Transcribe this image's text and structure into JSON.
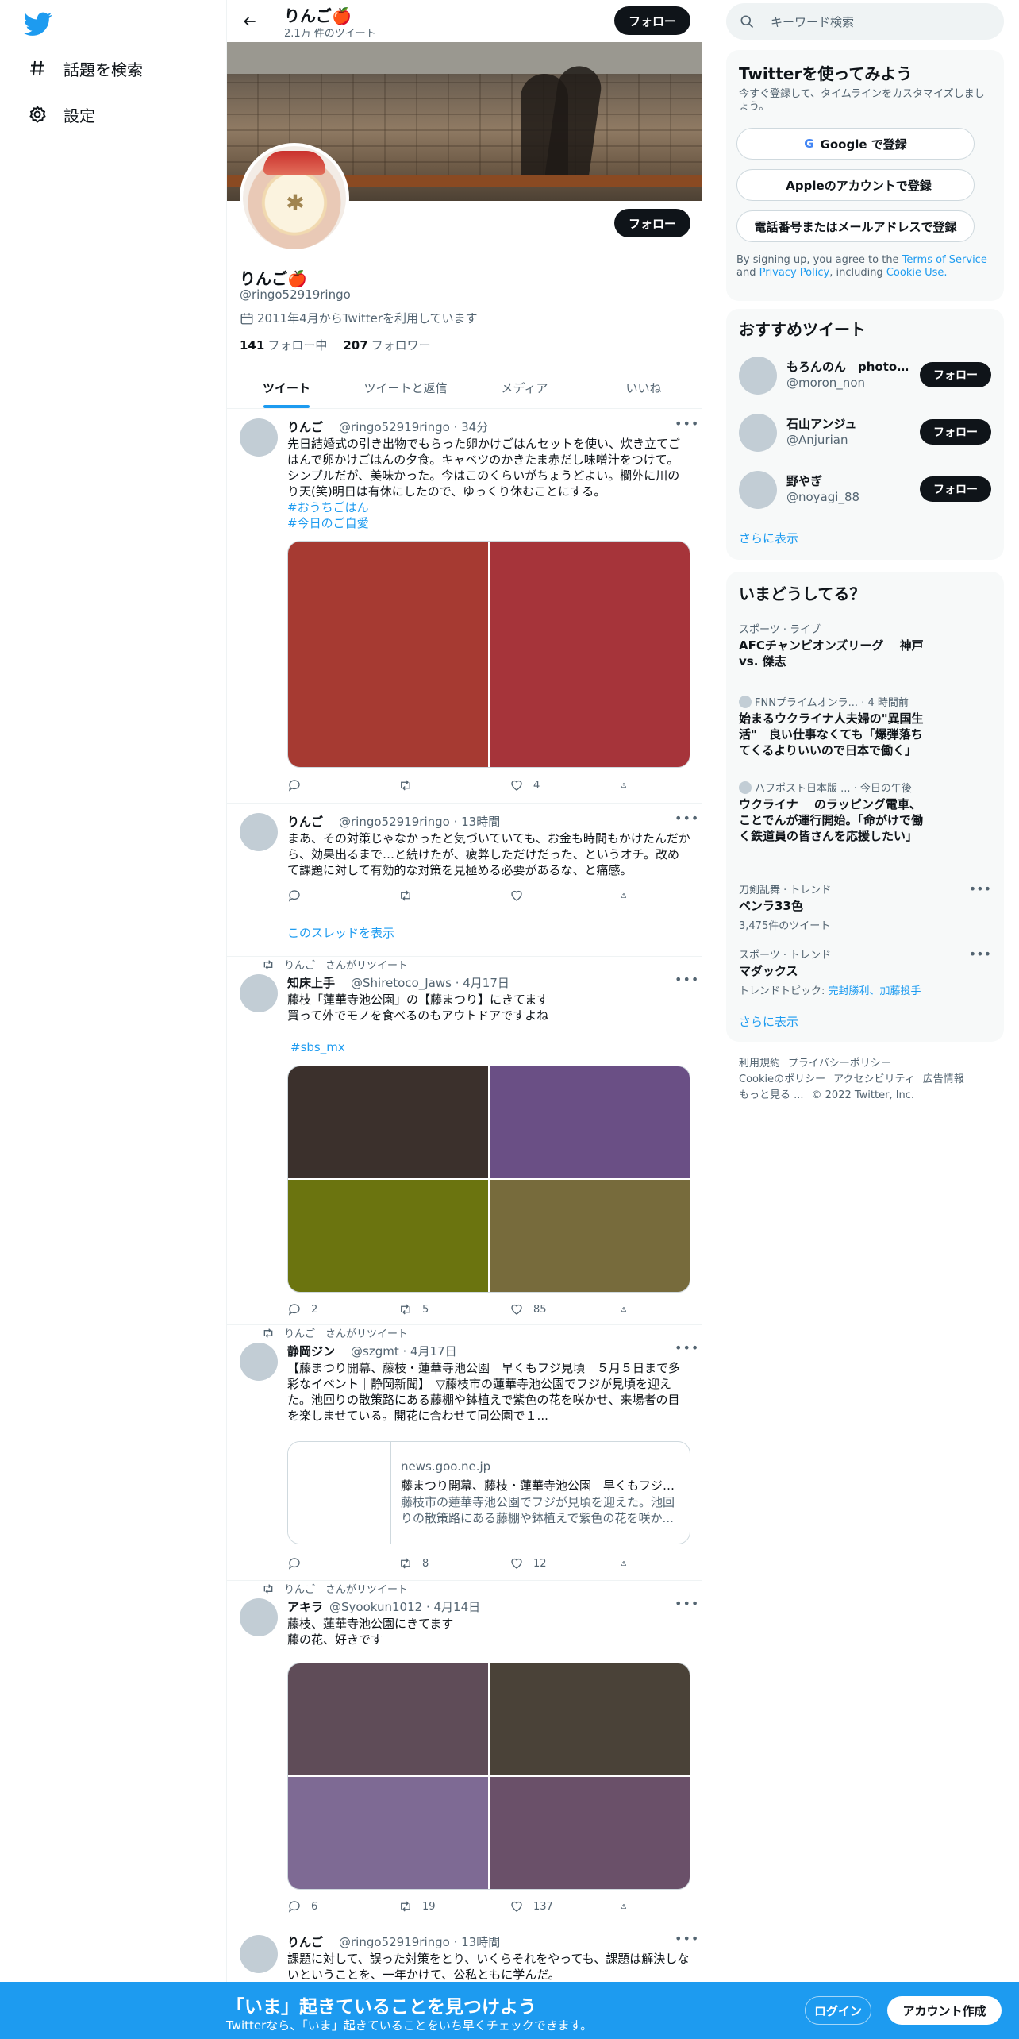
{
  "nav": {
    "explore_label": "話題を検索",
    "settings_label": "設定"
  },
  "header": {
    "name": "りんご🍎",
    "tweet_count": "2.1万 件のツイート",
    "follow_label": "フォロー"
  },
  "profile": {
    "name": "りんご🍎",
    "handle": "@ringo52919ringo",
    "joined": "2011年4月からTwitterを利用しています",
    "following_count": "141",
    "following_label": "フォロー中",
    "followers_count": "207",
    "followers_label": "フォロワー",
    "follow_label": "フォロー"
  },
  "tabs": [
    "ツイート",
    "ツイートと返信",
    "メディア",
    "いいね"
  ],
  "tweets": [
    {
      "name": "りんご",
      "handle_time": "@ringo52919ringo · 34分",
      "text": "先日結婚式の引き出物でもらった卵かけごはんセットを使い、炊き立てごはんで卵かけごはんの夕食。キャベツのかきたま赤だし味噌汁をつけて。シンプルだが、美味かった。今はこのくらいがちょうどよい。欄外に川のり天(笑)明日は有休にしたので、ゆっくり休むことにする。",
      "tags": [
        "#おうちごはん",
        "#今日のご自愛"
      ],
      "reply": "",
      "retweet": "",
      "like": "4",
      "media_colors": [
        "#a63a32",
        "#a6343a"
      ]
    },
    {
      "name": "りんご",
      "handle_time": "@ringo52919ringo · 13時間",
      "text": "まあ、その対策じゃなかったと気づいていても、お金も時間もかけたんだから、効果出るまで…と続けたが、疲弊しただけだった、というオチ。改めて課題に対して有効的な対策を見極める必要があるな、と痛感。",
      "reply": "",
      "retweet": "",
      "like": "",
      "show_thread": "このスレッドを表示"
    },
    {
      "rt_by": "りんご　さんがリツイート",
      "name": "知床上手",
      "handle_time": "@Shiretoco_Jaws · 4月17日",
      "text": "藤枝「蓮華寺池公園」の【藤まつり】にきてます\n買って外でモノを食べるのもアウトドアですよね",
      "tags": [
        "#sbs_mx"
      ],
      "reply": "2",
      "retweet": "5",
      "like": "85",
      "media_colors": [
        "#3b302c",
        "#6a4f85",
        "#6b740f",
        "#776b3c"
      ]
    },
    {
      "rt_by": "りんご　さんがリツイート",
      "name": "静岡ジン",
      "handle_time": "@szgmt · 4月17日",
      "text": "【藤まつり開幕、藤枝・蓮華寺池公園　早くもフジ見頃　５月５日まで多彩なイベント｜静岡新聞】　▽藤枝市の蓮華寺池公園でフジが見頃を迎えた。池回りの散策路にある藤棚や鉢植えで紫色の花を咲かせ、来場者の目を楽しませている。開花に合わせて同公園で１...",
      "card_domain": "news.goo.ne.jp",
      "card_title": "藤まつり開幕、藤枝・蓮華寺池公園　早くもフジ見頃",
      "card_desc": "藤枝市の蓮華寺池公園でフジが見頃を迎えた。池回りの散策路にある藤棚や鉢植えで紫色の花を咲か...",
      "reply": "",
      "retweet": "8",
      "like": "12"
    },
    {
      "rt_by": "りんご　さんがリツイート",
      "name": "アキラ",
      "handle_time": "@Syookun1012 · 4月14日",
      "text": "藤枝、蓮華寺池公園にきてます\n藤の花、好きです",
      "reply": "6",
      "retweet": "19",
      "like": "137",
      "media_colors": [
        "#5f4c58",
        "#4a4238",
        "#7e6a94",
        "#6a5069"
      ]
    },
    {
      "name": "りんご",
      "handle_time": "@ringo52919ringo · 13時間",
      "text": "課題に対して、誤った対策をとり、いくらそれをやっても、課題は解決しないということを、一年かけて、公私ともに学んだ。"
    }
  ],
  "search": {
    "placeholder": "キーワード検索"
  },
  "signup_card": {
    "title": "Twitterを使ってみよう",
    "subtitle": "今すぐ登録して、タイムラインをカスタマイズしましょう。",
    "google_label": "Google で登録",
    "apple_label": "Appleのアカウントで登録",
    "phone_label": "電話番号またはメールアドレスで登録",
    "terms_prefix": "By signing up, you agree to the",
    "terms_link": "Terms of Service",
    "terms_and": "and",
    "privacy_link": "Privacy Policy",
    "terms_including": ", including",
    "cookie_link": "Cookie Use."
  },
  "recommend": {
    "title": "おすすめツイート",
    "users": [
      {
        "name": "もろんのん　photog...",
        "handle": "@moron_non",
        "button": "フォロー"
      },
      {
        "name": "石山アンジュ",
        "handle": "@Anjurian",
        "button": "フォロー"
      },
      {
        "name": "野やぎ",
        "handle": "@noyagi_88",
        "button": "フォロー"
      }
    ],
    "more": "さらに表示"
  },
  "trends": {
    "title": "いまどうしてる？",
    "items": [
      {
        "context": "スポーツ · ライブ",
        "title": "AFCチャンピオンズリーグ　 神戸 vs. 傑志"
      },
      {
        "context": "FNNプライムオンラ... · 4 時間前",
        "title": "始まるウクライナ人夫婦の\"異国生活\"　良い仕事なくても「爆弾落ちてくるよりいいので日本で働く」"
      },
      {
        "context": "ハフポスト日本版 ... · 今日の午後",
        "title": "ウクライナ　 のラッピング電車、ことでんが運行開始。「命がけで働く鉄道員の皆さんを応援したい」"
      },
      {
        "context": "刀剣乱舞 · トレンド",
        "title": "ペンラ33色",
        "count": "3,475件のツイート"
      },
      {
        "context": "スポーツ · トレンド",
        "title": "マダックス",
        "count_prefix": "トレンドトピック:",
        "count_links": "完封勝利、加藤投手"
      }
    ],
    "more": "さらに表示"
  },
  "footer": {
    "links": [
      "利用規約",
      "プライバシーポリシー",
      "Cookieのポリシー",
      "アクセシビリティ",
      "広告情報",
      "もっと見る ...",
      "© 2022 Twitter, Inc."
    ]
  },
  "bottom_bar": {
    "title": "「いま」起きていることを見つけよう",
    "subtitle": "Twitterなら、「いま」起きていることをいち早くチェックできます。",
    "login": "ログイン",
    "signup": "アカウント作成"
  },
  "colors": {
    "accent": "#1d9bf0",
    "text": "#0f1419",
    "muted": "#536471"
  }
}
